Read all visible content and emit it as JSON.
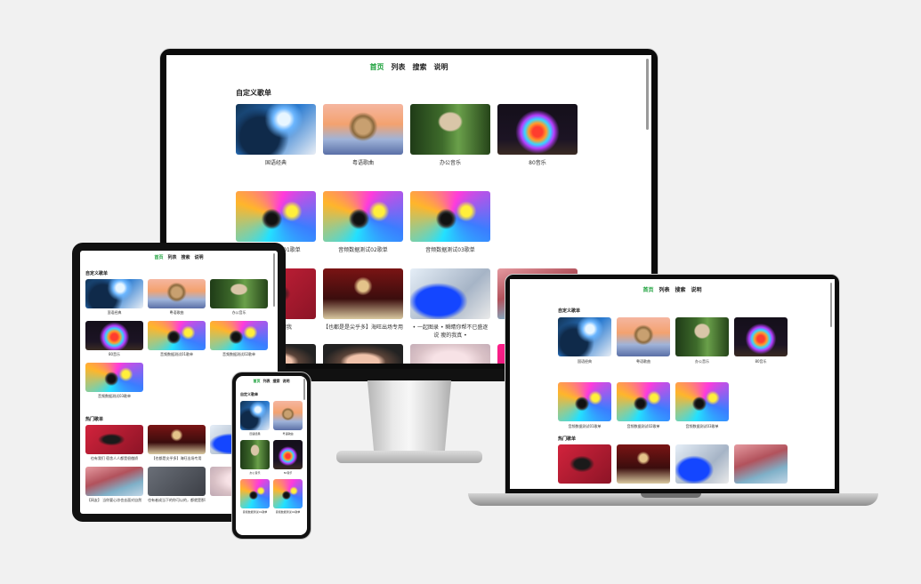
{
  "nav": [
    {
      "label": "首页",
      "active": true
    },
    {
      "label": "列表",
      "active": false
    },
    {
      "label": "搜索",
      "active": false
    },
    {
      "label": "说明",
      "active": false
    }
  ],
  "section_custom": "自定义歌单",
  "section_hot": "热门歌单",
  "custom_playlists": [
    {
      "name": "国语经典",
      "art": "anime"
    },
    {
      "name": "粤语歌曲",
      "art": "robot"
    },
    {
      "name": "办公音乐",
      "art": "mushroom"
    },
    {
      "name": "80音乐",
      "art": "burst"
    },
    {
      "name": "音频数据测试01歌单",
      "art": "speaker"
    },
    {
      "name": "音频数据测试02歌单",
      "art": "speaker"
    },
    {
      "name": "音频数据测试03歌单",
      "art": "speaker"
    }
  ],
  "hot_playlists": [
    {
      "name": "…员进进跟我",
      "art": "red"
    },
    {
      "name": "【也都是是尖乎多】海旺出场专用",
      "art": "queen"
    },
    {
      "name": "• 一起图录 • 瞬睛你帮不已盛逐说 瘦的我真 •",
      "art": "blue"
    },
    {
      "name": "",
      "art": "wave"
    },
    {
      "name": "",
      "art": "face"
    },
    {
      "name": "",
      "art": "face"
    },
    {
      "name": "",
      "art": "pale"
    },
    {
      "name": "",
      "art": "magenta"
    }
  ],
  "tablet_hot_captions": [
    "也有我们 宿舍人人都是很傲娇",
    "【也都是尖乎多】海旺出场专用",
    "一起图…"
  ],
  "tablet_hot_captions_row2": [
    "【网友】 当你要心凉也去面对自然",
    "也有者成当下的你可以的，都就是那事情",
    "…"
  ]
}
